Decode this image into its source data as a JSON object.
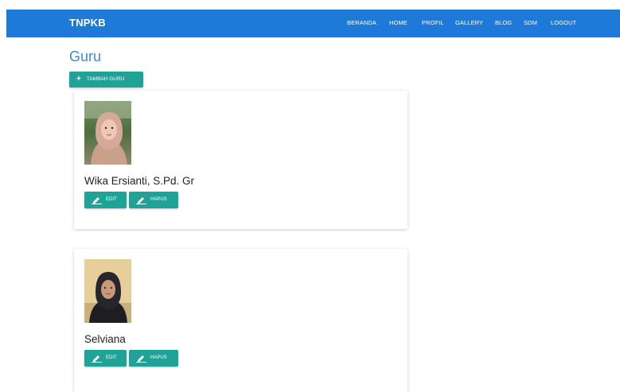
{
  "navbar": {
    "brand": "TNPKB",
    "items": [
      {
        "label": "BERANDA"
      },
      {
        "label": "HOME"
      },
      {
        "label": "PROFIL"
      },
      {
        "label": "GALLERY"
      },
      {
        "label": "BLOG"
      },
      {
        "label": "SDM"
      },
      {
        "label": "LOGOUT"
      }
    ],
    "color": "#1e7ad8"
  },
  "page": {
    "title": "Guru",
    "add_button_label": "TAMBAH GURU",
    "accent_color": "#1ea396",
    "title_color": "#3d8ad4"
  },
  "teachers": [
    {
      "name": "Wika Ersianti, S.Pd. Gr",
      "edit_label": "EDIT",
      "delete_label": "HAPUS",
      "photo_icon": "teacher-photo"
    },
    {
      "name": "Selviana",
      "edit_label": "EDIT",
      "delete_label": "HAPUS",
      "photo_icon": "teacher-photo"
    }
  ]
}
